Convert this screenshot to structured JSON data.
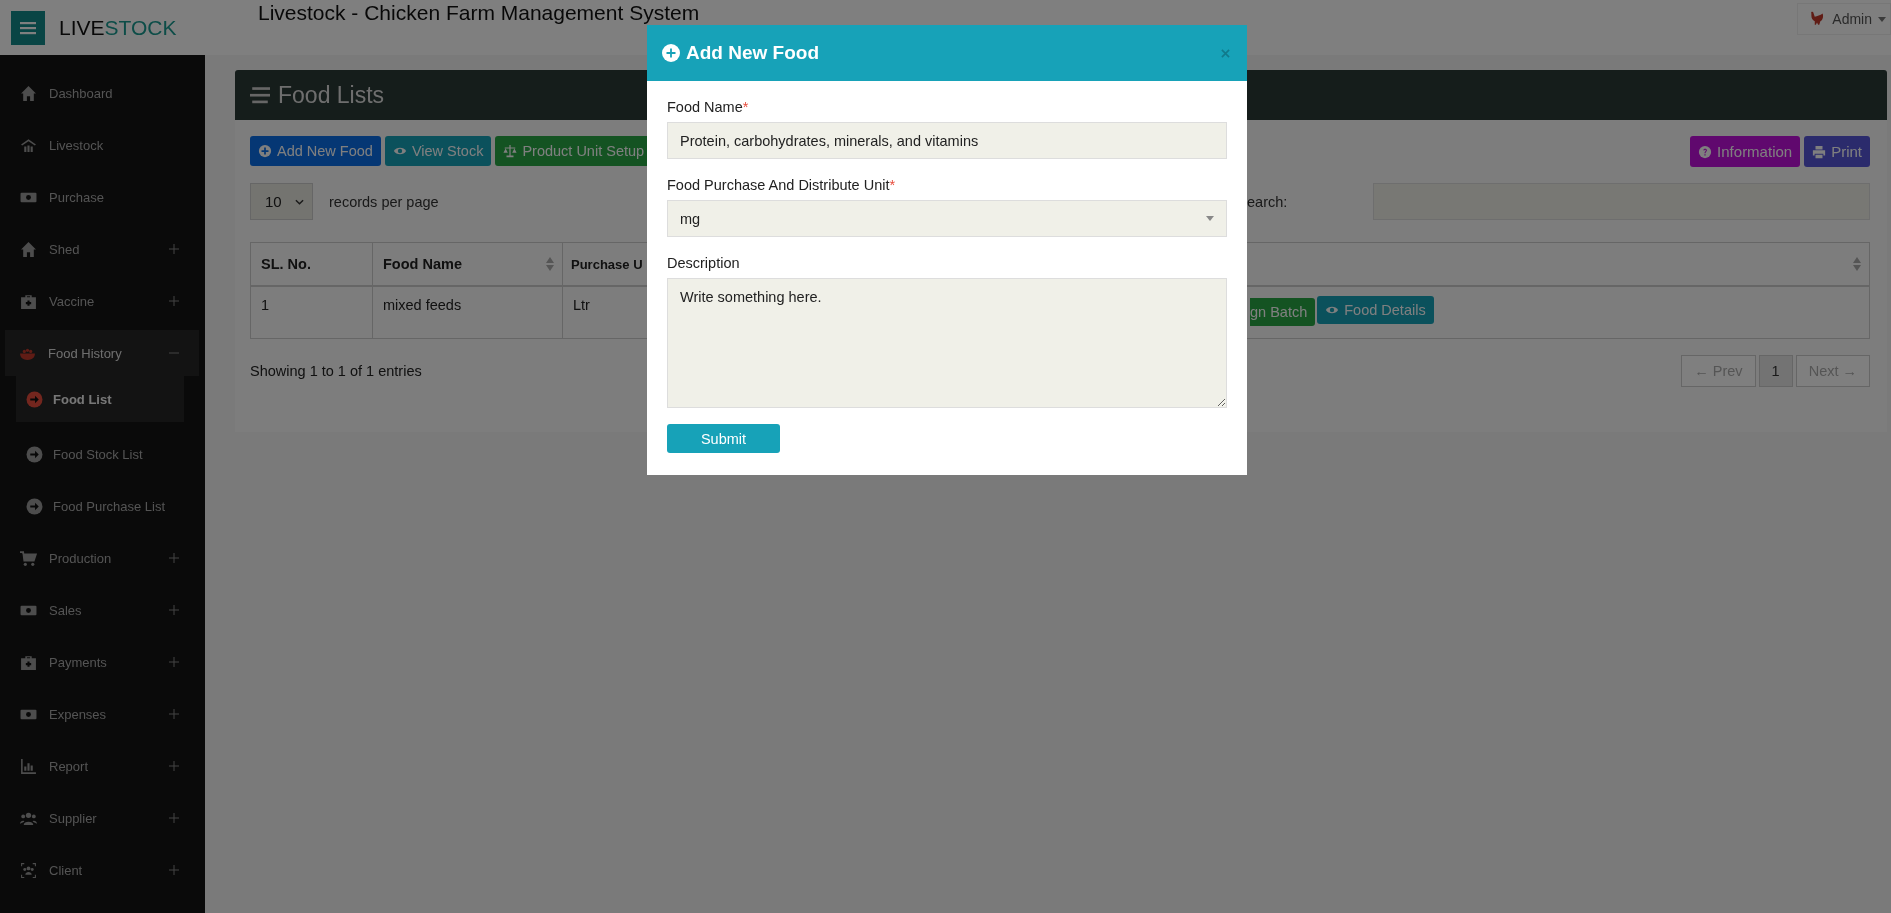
{
  "header": {
    "brand_left": "LIVE",
    "brand_right": "STOCK",
    "title": "Livestock - Chicken Farm Management System",
    "user": "Admin"
  },
  "sidebar": {
    "items": [
      {
        "label": "Dashboard"
      },
      {
        "label": "Livestock"
      },
      {
        "label": "Purchase"
      },
      {
        "label": "Shed",
        "expanded": false
      },
      {
        "label": "Vaccine",
        "expanded": false
      },
      {
        "label": "Food History",
        "expanded": true,
        "children": [
          {
            "label": "Food List",
            "selected": true
          },
          {
            "label": "Food Stock List",
            "selected": false
          },
          {
            "label": "Food Purchase List",
            "selected": false
          }
        ]
      },
      {
        "label": "Production",
        "expanded": false
      },
      {
        "label": "Sales",
        "expanded": false
      },
      {
        "label": "Payments",
        "expanded": false
      },
      {
        "label": "Expenses",
        "expanded": false
      },
      {
        "label": "Report",
        "expanded": false
      },
      {
        "label": "Supplier",
        "expanded": false
      },
      {
        "label": "Client",
        "expanded": false
      }
    ]
  },
  "panel": {
    "title": "Food Lists",
    "toolbar": [
      {
        "label": "Add New Food",
        "kind": "primary"
      },
      {
        "label": "View Stock",
        "kind": "info"
      },
      {
        "label": "Product Unit Setup",
        "kind": "success"
      }
    ],
    "toolbar_right": [
      {
        "label": "Information",
        "kind": "purple"
      },
      {
        "label": "Print",
        "kind": "indigo"
      }
    ],
    "page_size": "10",
    "page_size_label": "records per page",
    "search_label": "earch:",
    "table": {
      "columns": [
        {
          "label": "SL. No.",
          "sortable": false
        },
        {
          "label": "Food Name",
          "sortable": true
        },
        {
          "label": "Purchase U"
        },
        {
          "sortable": true
        }
      ],
      "rows": [
        {
          "cells": [
            "1",
            "mixed feeds",
            "Ltr"
          ],
          "actions": [
            {
              "label": "gn Batch",
              "kind": "success"
            },
            {
              "label": "Food Details",
              "kind": "info"
            }
          ]
        }
      ]
    },
    "summary": "Showing 1 to 1 of 1 entries",
    "pagination": [
      {
        "label": "← Prev",
        "disabled": true,
        "selected": false
      },
      {
        "label": "1",
        "disabled": false,
        "selected": true
      },
      {
        "label": "Next →",
        "disabled": true,
        "selected": false
      }
    ]
  },
  "modal": {
    "title": "Add New Food",
    "fields": [
      {
        "kind": "text",
        "label": "Food Name",
        "required": true,
        "value": "Protein, carbohydrates, minerals, and vitamins"
      },
      {
        "kind": "select",
        "label": "Food Purchase And Distribute Unit",
        "required": true,
        "value": "mg"
      },
      {
        "kind": "textarea",
        "label": "Description",
        "required": false,
        "placeholder": "Write something here."
      }
    ],
    "required_mark": "*",
    "submit": "Submit"
  }
}
